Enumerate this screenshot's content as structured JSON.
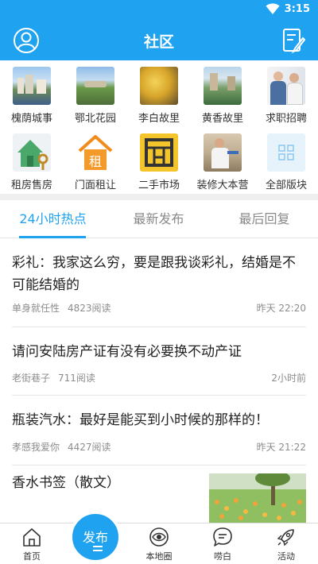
{
  "status": {
    "time": "3:15"
  },
  "header": {
    "title": "社区"
  },
  "categories": [
    {
      "label": "槐荫城事",
      "icon": "city-photo"
    },
    {
      "label": "鄂北花园",
      "icon": "garden-photo"
    },
    {
      "label": "李白故里",
      "icon": "ginkgo-photo"
    },
    {
      "label": "黄香故里",
      "icon": "park-photo"
    },
    {
      "label": "求职招聘",
      "icon": "office-photo"
    },
    {
      "label": "租房售房",
      "icon": "house-key-icon"
    },
    {
      "label": "门面租让",
      "icon": "shop-rent-icon"
    },
    {
      "label": "二手市场",
      "icon": "secondhand-icon"
    },
    {
      "label": "装修大本营",
      "icon": "renovation-photo"
    },
    {
      "label": "全部版块",
      "icon": "all-sections-icon"
    }
  ],
  "tabs": [
    {
      "label": "24小时热点",
      "active": true
    },
    {
      "label": "最新发布",
      "active": false
    },
    {
      "label": "最后回复",
      "active": false
    }
  ],
  "posts": [
    {
      "title": "彩礼：我家这么穷，要是跟我谈彩礼，结婚是不可能结婚的",
      "author": "单身就任性",
      "reads": "4823阅读",
      "time": "昨天 22:20"
    },
    {
      "title": "请问安陆房产证有没有必要换不动产证",
      "author": "老街巷子",
      "reads": "711阅读",
      "time": "2小时前"
    },
    {
      "title": "瓶装汽水：最好是能买到小时候的那样的！",
      "author": "孝感我爱你",
      "reads": "4427阅读",
      "time": "昨天 21:22"
    },
    {
      "title": "香水书签（散文）"
    }
  ],
  "bottomnav": {
    "home": "首页",
    "publish": "发布",
    "local": "本地圈",
    "chat": "唠白",
    "activity": "活动"
  },
  "colors": {
    "accent": "#1fa3f0"
  }
}
